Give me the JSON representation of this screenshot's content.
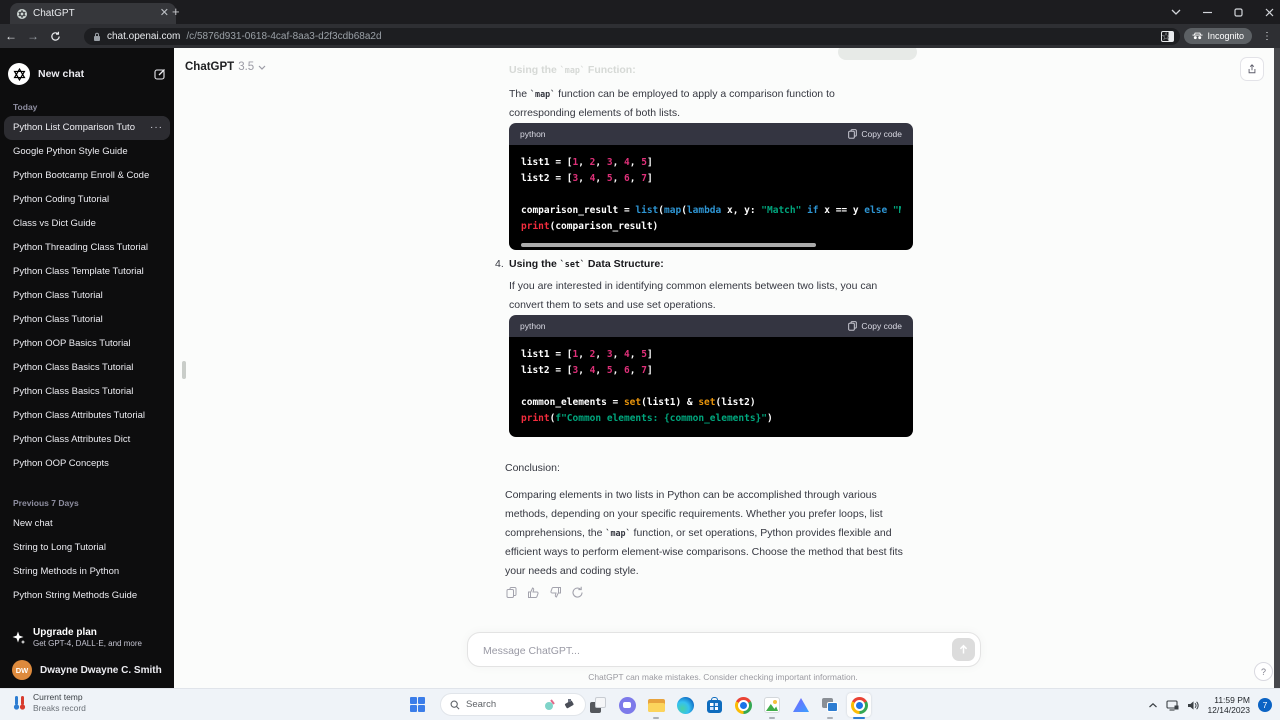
{
  "colors": {
    "kw": "#2e95d3",
    "num": "#df3079",
    "str": "#00a67d",
    "bi": "#e9950c",
    "fn": "#f22c3d",
    "avatar": "#dd8a3d",
    "badge": "#0b63c4"
  },
  "browser": {
    "tab_title": "ChatGPT",
    "url_host": "chat.openai.com",
    "url_path": "/c/5876d931-0618-4caf-8aa3-d2f3cdb68a2d",
    "incognito_label": "Incognito"
  },
  "sidebar": {
    "new_chat_label": "New chat",
    "active_section": 0,
    "active_index": 0,
    "sections": [
      {
        "label": "Today",
        "items": [
          "Python List Comparison Tuto",
          "Google Python Style Guide",
          "Python Bootcamp Enroll & Code",
          "Python Coding Tutorial",
          "Class vs Dict Guide",
          "Python Threading Class Tutorial",
          "Python Class Template Tutorial",
          "Python Class Tutorial",
          "Python Class Tutorial",
          "Python OOP Basics Tutorial",
          "Python Class Basics Tutorial",
          "Python Class Basics Tutorial",
          "Python Class Attributes Tutorial",
          "Python Class Attributes Dict",
          "Python OOP Concepts"
        ]
      },
      {
        "label": "Previous 7 Days",
        "items": [
          "New chat",
          "String to Long Tutorial",
          "String Methods in Python",
          "Python String Methods Guide"
        ]
      }
    ],
    "menu_dots": "···",
    "upgrade": {
      "title": "Upgrade plan",
      "subtitle": "Get GPT-4, DALL·E, and more"
    },
    "account": {
      "initials": "DW",
      "name": "Dwayne Dwayne C. Smith"
    }
  },
  "header": {
    "model_name": "ChatGPT",
    "model_version": "3.5"
  },
  "conversation": {
    "faded_heading_parts": [
      {
        "t": "Using the "
      },
      {
        "t": "`map`",
        "c": true
      },
      {
        "t": " Function:"
      }
    ],
    "para1_parts": [
      {
        "t": "The "
      },
      {
        "t": "`map`",
        "c": true
      },
      {
        "t": " function can be employed to apply a comparison function to corresponding elements of both lists."
      }
    ],
    "item4": {
      "marker": "4.",
      "title_parts": [
        {
          "t": "Using the "
        },
        {
          "t": "`set`",
          "c": true
        },
        {
          "t": " Data Structure:"
        }
      ],
      "body": "If you are interested in identifying common elements between two lists, you can convert them to sets and use set operations."
    },
    "conclusion_label": "Conclusion:",
    "conclusion_parts": [
      {
        "t": "Comparing elements in two lists in Python can be accomplished through various methods, depending on your specific requirements. Whether you prefer loops, list comprehensions, the "
      },
      {
        "t": "`map`",
        "c": true
      },
      {
        "t": " function, or set operations, Python provides flexible and efficient ways to perform element-wise comparisons. Choose the method that best fits your needs and coding style."
      }
    ],
    "code_blocks": [
      {
        "lang": "python",
        "copy_label": "Copy code",
        "lines": [
          [
            [
              "list1 = [",
              "pl"
            ],
            [
              "1",
              "num"
            ],
            [
              ", ",
              "pl"
            ],
            [
              "2",
              "num"
            ],
            [
              ", ",
              "pl"
            ],
            [
              "3",
              "num"
            ],
            [
              ", ",
              "pl"
            ],
            [
              "4",
              "num"
            ],
            [
              ", ",
              "pl"
            ],
            [
              "5",
              "num"
            ],
            [
              "]",
              "pl"
            ]
          ],
          [
            [
              "list2 = [",
              "pl"
            ],
            [
              "3",
              "num"
            ],
            [
              ", ",
              "pl"
            ],
            [
              "4",
              "num"
            ],
            [
              ", ",
              "pl"
            ],
            [
              "5",
              "num"
            ],
            [
              ", ",
              "pl"
            ],
            [
              "6",
              "num"
            ],
            [
              ", ",
              "pl"
            ],
            [
              "7",
              "num"
            ],
            [
              "]",
              "pl"
            ]
          ],
          [],
          [
            [
              "comparison_result = ",
              "pl"
            ],
            [
              "list",
              "kw"
            ],
            [
              "(",
              "pl"
            ],
            [
              "map",
              "kw"
            ],
            [
              "(",
              "pl"
            ],
            [
              "lambda",
              "kw"
            ],
            [
              " x, y: ",
              "pl"
            ],
            [
              "\"Match\"",
              "str"
            ],
            [
              " ",
              "pl"
            ],
            [
              "if",
              "kw"
            ],
            [
              " x == y ",
              "pl"
            ],
            [
              "else",
              "kw"
            ],
            [
              " ",
              "pl"
            ],
            [
              "\"Misma",
              "str"
            ]
          ],
          [
            [
              "print",
              "fn"
            ],
            [
              "(comparison_result)",
              "pl"
            ]
          ]
        ]
      },
      {
        "lang": "python",
        "copy_label": "Copy code",
        "lines": [
          [
            [
              "list1 = [",
              "pl"
            ],
            [
              "1",
              "num"
            ],
            [
              ", ",
              "pl"
            ],
            [
              "2",
              "num"
            ],
            [
              ", ",
              "pl"
            ],
            [
              "3",
              "num"
            ],
            [
              ", ",
              "pl"
            ],
            [
              "4",
              "num"
            ],
            [
              ", ",
              "pl"
            ],
            [
              "5",
              "num"
            ],
            [
              "]",
              "pl"
            ]
          ],
          [
            [
              "list2 = [",
              "pl"
            ],
            [
              "3",
              "num"
            ],
            [
              ", ",
              "pl"
            ],
            [
              "4",
              "num"
            ],
            [
              ", ",
              "pl"
            ],
            [
              "5",
              "num"
            ],
            [
              ", ",
              "pl"
            ],
            [
              "6",
              "num"
            ],
            [
              ", ",
              "pl"
            ],
            [
              "7",
              "num"
            ],
            [
              "]",
              "pl"
            ]
          ],
          [],
          [
            [
              "common_elements = ",
              "pl"
            ],
            [
              "set",
              "bi"
            ],
            [
              "(list1) & ",
              "pl"
            ],
            [
              "set",
              "bi"
            ],
            [
              "(list2)",
              "pl"
            ]
          ],
          [
            [
              "print",
              "fn"
            ],
            [
              "(",
              "pl"
            ],
            [
              "f",
              "str"
            ],
            [
              "\"Common elements: {common_elements}\"",
              "str"
            ],
            [
              ")",
              "pl"
            ]
          ]
        ]
      }
    ]
  },
  "composer": {
    "placeholder": "Message ChatGPT...",
    "disclaimer": "ChatGPT can make mistakes. Consider checking important information.",
    "help": "?"
  },
  "taskbar": {
    "widget": {
      "line1": "Current temp",
      "line2": "Breaks record"
    },
    "search_label": "Search",
    "tray": {
      "time": "11:59 PM",
      "date": "12/14/2023",
      "badge": "7"
    }
  }
}
